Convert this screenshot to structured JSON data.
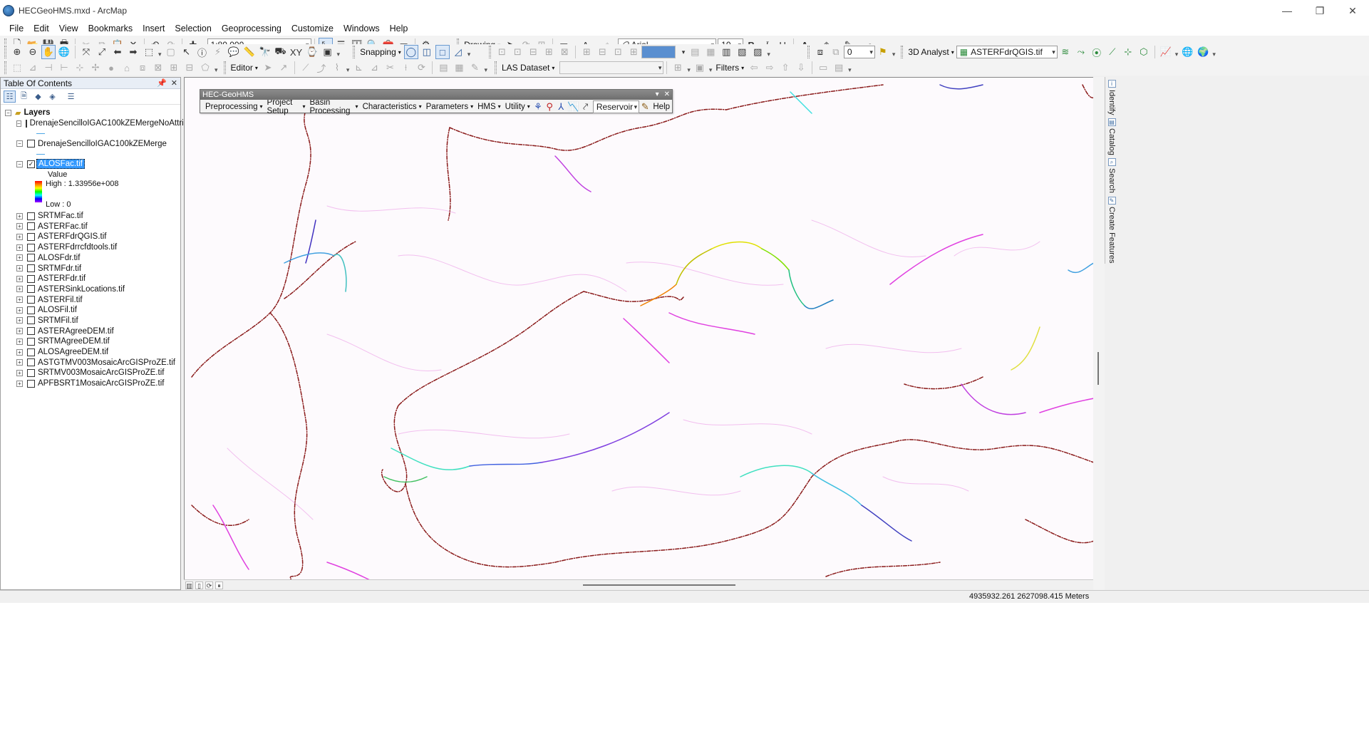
{
  "window": {
    "title": "HECGeoHMS.mxd - ArcMap",
    "minimize": "—",
    "restore": "❐",
    "close": "✕"
  },
  "menu": [
    "File",
    "Edit",
    "View",
    "Bookmarks",
    "Insert",
    "Selection",
    "Geoprocessing",
    "Customize",
    "Windows",
    "Help"
  ],
  "toolbar": {
    "scale": "1:80,000",
    "drawing_label": "Drawing",
    "font_name": "Arial",
    "font_size": "10",
    "bold": "B",
    "italic": "I",
    "underline": "U",
    "snapping_label": "Snapping",
    "three_d_analyst_label": "3D Analyst",
    "analyst_layer": "ASTERFdrQGIS.tif",
    "layer_index": "0",
    "editor_label": "Editor",
    "las_dataset_label": "LAS Dataset",
    "filters_label": "Filters"
  },
  "colors": {
    "font_color": "#000000",
    "fill_color": "#f5c400",
    "line_color": "#00a000",
    "marker_color": "#0060c0"
  },
  "toc": {
    "title": "Table Of Contents",
    "root": "Layers",
    "layers": [
      {
        "name": "DrenajeSencilloIGAC100kZEMergeNoAttrib",
        "checked": false,
        "expanded": true
      },
      {
        "name": "DrenajeSencilloIGAC100kZEMerge",
        "checked": false,
        "expanded": true
      },
      {
        "name": "ALOSFac.tif",
        "checked": true,
        "expanded": true,
        "selected": true
      },
      {
        "name": "SRTMFac.tif",
        "checked": false
      },
      {
        "name": "ASTERFac.tif",
        "checked": false
      },
      {
        "name": "ASTERFdrQGIS.tif",
        "checked": false
      },
      {
        "name": "ASTERFdrrcfdtools.tif",
        "checked": false
      },
      {
        "name": "ALOSFdr.tif",
        "checked": false
      },
      {
        "name": "SRTMFdr.tif",
        "checked": false
      },
      {
        "name": "ASTERFdr.tif",
        "checked": false
      },
      {
        "name": "ASTERSinkLocations.tif",
        "checked": false
      },
      {
        "name": "ASTERFil.tif",
        "checked": false
      },
      {
        "name": "ALOSFil.tif",
        "checked": false
      },
      {
        "name": "SRTMFil.tif",
        "checked": false
      },
      {
        "name": "ASTERAgreeDEM.tif",
        "checked": false
      },
      {
        "name": "SRTMAgreeDEM.tif",
        "checked": false
      },
      {
        "name": "ALOSAgreeDEM.tif",
        "checked": false
      },
      {
        "name": "ASTGTMV003MosaicArcGISProZE.tif",
        "checked": false
      },
      {
        "name": "SRTMV003MosaicArcGISProZE.tif",
        "checked": false
      },
      {
        "name": "APFBSRT1MosaicArcGISProZE.tif",
        "checked": false
      }
    ],
    "legend": {
      "value_label": "Value",
      "high_label": "High : 1.33956e+008",
      "low_label": "Low : 0"
    }
  },
  "hec_geohms": {
    "title": "HEC-GeoHMS",
    "menus": [
      "Preprocessing",
      "Project Setup",
      "Basin Processing",
      "Characteristics",
      "Parameters",
      "HMS",
      "Utility"
    ],
    "dropdown_value": "Reservoir",
    "help_label": "Help"
  },
  "dock_tabs": [
    "Identify",
    "Catalog",
    "Search",
    "Create Features"
  ],
  "status": {
    "coordinates": "4935932.261  2627098.415 Meters"
  }
}
